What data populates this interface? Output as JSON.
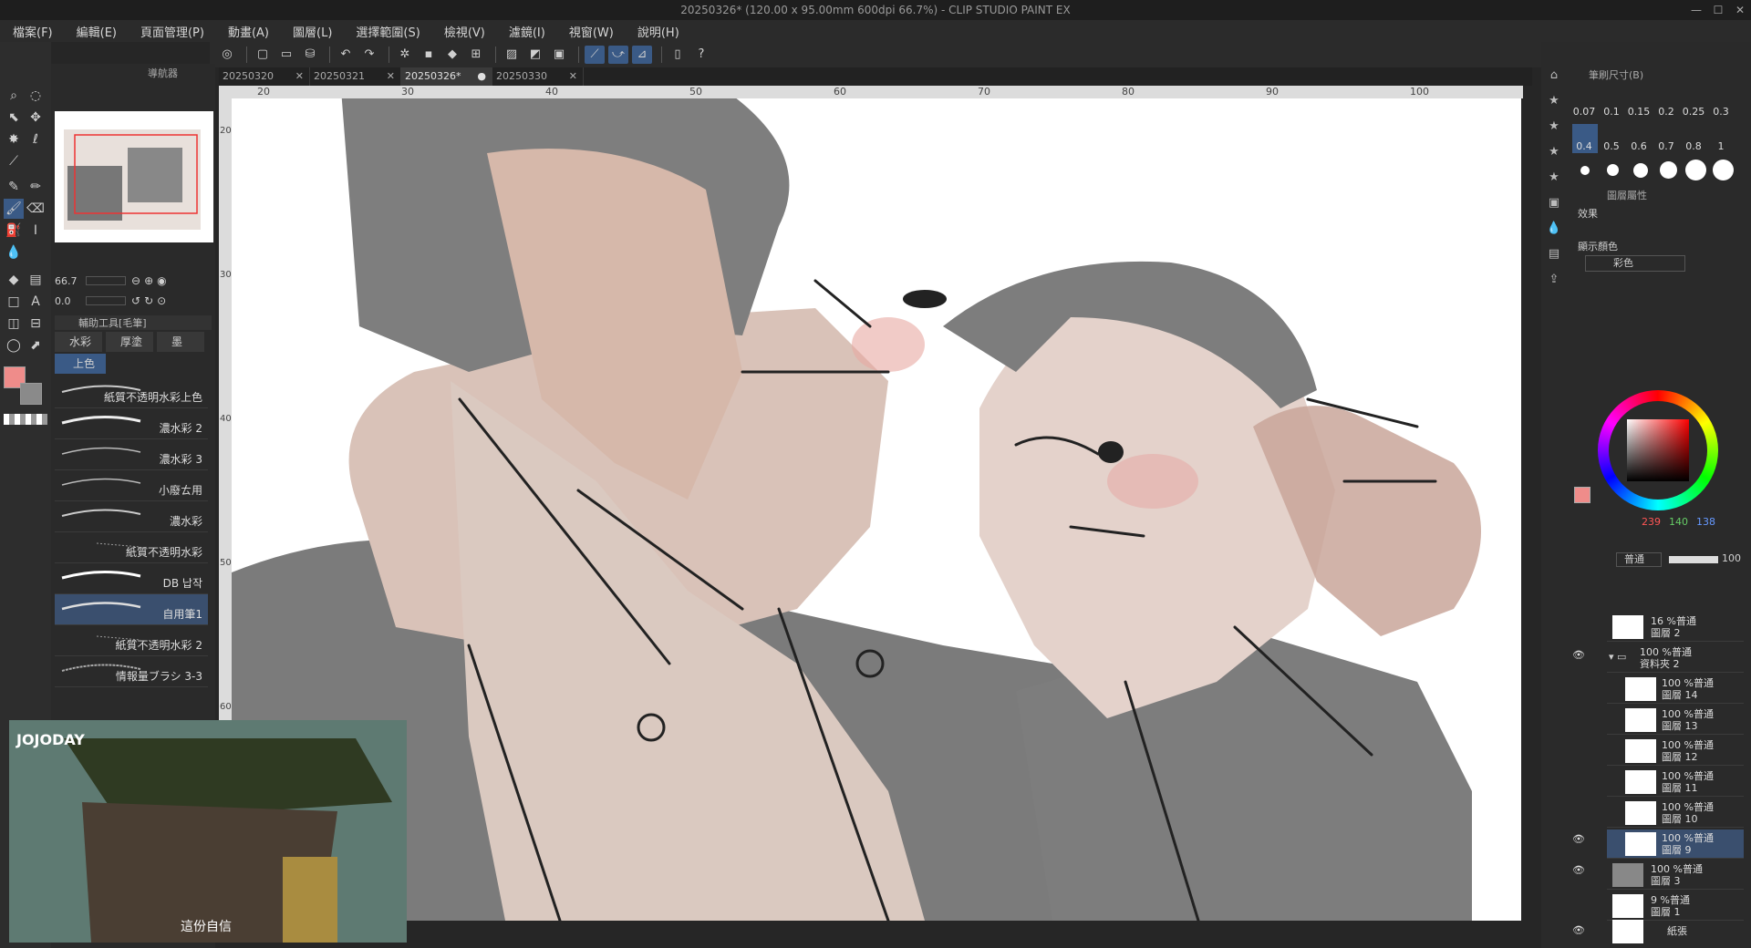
{
  "window": {
    "title": "20250326* (120.00 x 95.00mm 600dpi 66.7%) - CLIP STUDIO PAINT EX",
    "controls": [
      "—",
      "☐",
      "✕"
    ]
  },
  "menu": [
    "檔案(F)",
    "編輯(E)",
    "頁面管理(P)",
    "動畫(A)",
    "圖層(L)",
    "選擇範圍(S)",
    "檢視(V)",
    "濾鏡(I)",
    "視窗(W)",
    "說明(H)"
  ],
  "tabs": [
    {
      "label": "20250320",
      "active": false
    },
    {
      "label": "20250321",
      "active": false
    },
    {
      "label": "20250326*",
      "active": true
    },
    {
      "label": "20250330",
      "active": false
    }
  ],
  "ruler": {
    "marks": [
      "20",
      "30",
      "40",
      "50",
      "60",
      "70",
      "80",
      "90",
      "100"
    ],
    "vmarks": [
      "20",
      "30",
      "40",
      "50",
      "60"
    ]
  },
  "navigator": {
    "zoom": "66.7",
    "angle": "0.0",
    "tab_label": "導航器"
  },
  "subtool": {
    "header": "輔助工具[毛筆]",
    "groups": [
      "水彩",
      "厚塗",
      "墨"
    ],
    "active_group": "上色",
    "brushes": [
      {
        "name": "紙質不透明水彩上色",
        "selected": false
      },
      {
        "name": "濃水彩 2",
        "selected": false
      },
      {
        "name": "濃水彩 3",
        "selected": false
      },
      {
        "name": "小廢ㄊ用",
        "selected": false
      },
      {
        "name": "濃水彩",
        "selected": false
      },
      {
        "name": "紙質不透明水彩",
        "selected": false
      },
      {
        "name": "DB 납작",
        "selected": false
      },
      {
        "name": "自用筆1",
        "selected": true
      },
      {
        "name": "紙質不透明水彩 2",
        "selected": false
      },
      {
        "name": "情報量ブラシ 3-3",
        "selected": false
      }
    ]
  },
  "brush_sizes": [
    "0.07",
    "0.1",
    "0.15",
    "0.2",
    "0.25",
    "0.3",
    "0.4",
    "0.5",
    "0.6",
    "0.7",
    "0.8",
    "1"
  ],
  "brush_size_panel": "筆刷尺寸(B)",
  "layer_property": {
    "header": "圖層屬性",
    "effect_label": "效果",
    "display_color_label": "顯示顏色",
    "display_color_value": "彩色"
  },
  "color": {
    "main": "#EF8C8A",
    "r": "239",
    "g": "140",
    "b": "138"
  },
  "layer_panel": {
    "blend": "普通",
    "opacity": "100"
  },
  "layers": [
    {
      "line1": "16 %普通",
      "line2": "圖層 2",
      "visible": false,
      "selected": false
    },
    {
      "line1": "100 %普通",
      "line2": "資料夾 2",
      "visible": true,
      "selected": false,
      "folder": true
    },
    {
      "line1": "100 %普通",
      "line2": "圖層 14",
      "visible": false,
      "selected": false
    },
    {
      "line1": "100 %普通",
      "line2": "圖層 13",
      "visible": false,
      "selected": false
    },
    {
      "line1": "100 %普通",
      "line2": "圖層 12",
      "visible": false,
      "selected": false
    },
    {
      "line1": "100 %普通",
      "line2": "圖層 11",
      "visible": false,
      "selected": false
    },
    {
      "line1": "100 %普通",
      "line2": "圖層 10",
      "visible": false,
      "selected": false
    },
    {
      "line1": "100 %普通",
      "line2": "圖層 9",
      "visible": true,
      "selected": true
    },
    {
      "line1": "100 %普通",
      "line2": "圖層 3",
      "visible": true,
      "selected": false
    },
    {
      "line1": "9 %普通",
      "line2": "圖層 1",
      "visible": false,
      "selected": false
    },
    {
      "line1": "",
      "line2": "紙張",
      "visible": true,
      "selected": false
    }
  ],
  "video_overlay": {
    "logo": "JOJODAY",
    "caption": "這份自信"
  }
}
